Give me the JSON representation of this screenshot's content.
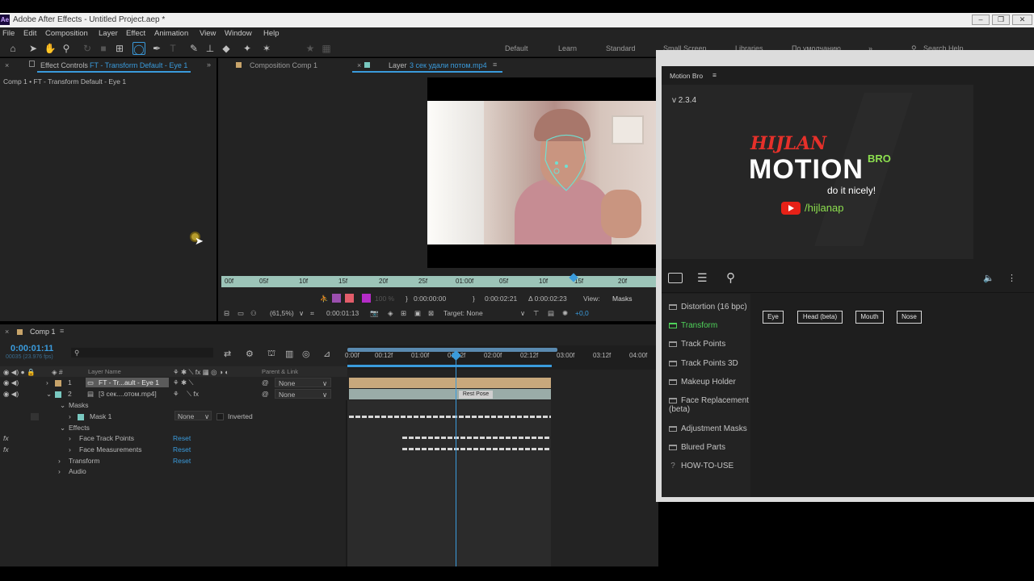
{
  "window": {
    "title": "Adobe After Effects - Untitled Project.aep *",
    "app_icon": "Ae"
  },
  "menu": [
    "File",
    "Edit",
    "Composition",
    "Layer",
    "Effect",
    "Animation",
    "View",
    "Window",
    "Help"
  ],
  "workspaces": [
    "Default",
    "Learn",
    "Standard",
    "Small Screen",
    "Libraries",
    "По умолчанию"
  ],
  "search_help": "Search Help",
  "effect_controls": {
    "tab_prefix": "Effect Controls",
    "tab_layer": "FT - Transform Default - Eye 1",
    "breadcrumb": "Comp 1 • FT - Transform Default - Eye 1"
  },
  "composition_tab": "Composition Comp 1",
  "layer_tab": {
    "prefix": "Layer",
    "name": "3 сек удали потом.mp4"
  },
  "layer_ruler": [
    "00f",
    "05f",
    "10f",
    "15f",
    "20f",
    "25f",
    "01:00f",
    "05f",
    "10f",
    "15f",
    "20f"
  ],
  "viewer_controls": {
    "tc_start": "0:00:00:00",
    "tc_end": "0:00:02:21",
    "tc_duration": "Δ 0:00:02:23",
    "view_label": "View:",
    "view_value": "Masks",
    "zoom": "(61,5%)",
    "tc_current": "0:00:01:13",
    "target": "Target: None",
    "exposure": "+0,0",
    "res": "100 %"
  },
  "timeline": {
    "tab": "Comp 1",
    "timecode": "0:00:01:11",
    "frame_info": "00035 (23.976 fps)",
    "ruler": [
      "0:00f",
      "00:12f",
      "01:00f",
      "01:12f",
      "02:00f",
      "02:12f",
      "03:00f",
      "03:12f",
      "04:00f"
    ],
    "headers": {
      "layer_name": "Layer Name",
      "parent": "Parent & Link"
    },
    "layers": [
      {
        "num": "1",
        "name": "FT - Tr...ault - Eye 1",
        "parent": "None"
      },
      {
        "num": "2",
        "name": "[3 сек....отом.mp4]",
        "parent": "None"
      }
    ],
    "props": {
      "masks": "Masks",
      "mask1": "Mask 1",
      "mask_mode": "None",
      "inverted": "Inverted",
      "effects": "Effects",
      "ftp": "Face Track Points",
      "fm": "Face Measurements",
      "transform": "Transform",
      "audio": "Audio",
      "reset": "Reset",
      "fx": "fx"
    },
    "rest_pose": "Rest Pose"
  },
  "motion_bro": {
    "title": "Motion Bro",
    "version": "v 2.3.4",
    "brand_top": "HIJLAN",
    "brand_main": "MOTION",
    "brand_badge": "BRO",
    "tagline": "do it nicely!",
    "channel": "/hijlanap",
    "categories": [
      "Distortion (16 bpc)",
      "Transform",
      "Track Points",
      "Track Points 3D",
      "Makeup Holder",
      "Face Replacement (beta)",
      "Adjustment Masks",
      "Blured Parts",
      "HOW-TO-USE"
    ],
    "active_category": "Transform",
    "presets": [
      "Eye",
      "Head (beta)",
      "Mouth",
      "Nose"
    ]
  },
  "colors": {
    "accent": "#3a9bdc",
    "active_green": "#4fd35a",
    "yt_red": "#e62117",
    "badge_green": "#8de04f"
  }
}
